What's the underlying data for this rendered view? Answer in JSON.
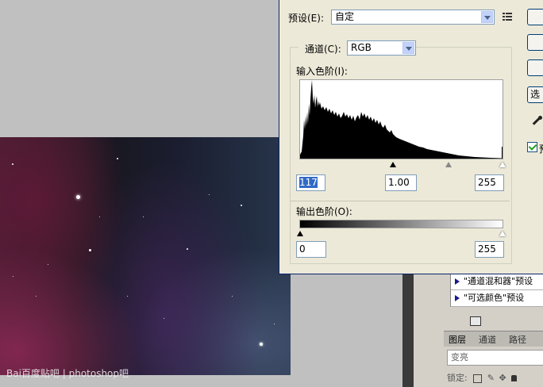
{
  "dialog": {
    "preset_label": "预设(E):",
    "preset_value": "自定",
    "channel_label": "通道(C):",
    "channel_value": "RGB",
    "input_levels_label": "输入色阶(I):",
    "output_levels_label": "输出色阶(O):",
    "input_black": "117",
    "input_gamma": "1.00",
    "input_white": "255",
    "output_black": "0",
    "output_white": "255",
    "button_partial": "选",
    "preview_partial": "预",
    "preset_menu_icon": "menu-list-icon",
    "eyedropper_icon": "eyedropper-icon"
  },
  "actions": {
    "items": [
      {
        "label": "\"通道混和器\"预设"
      },
      {
        "label": "\"可选颜色\"预设"
      }
    ]
  },
  "layers_panel": {
    "tabs": [
      "图层",
      "通道",
      "路径"
    ],
    "blend_mode": "变亮",
    "lock_label": "锁定:"
  },
  "watermark": {
    "text": "Bai百度贴吧 | photoshop吧"
  },
  "colors": {
    "dialog_bg": "#ece9d8",
    "selection": "#316ac5",
    "workspace": "#c0c0c0"
  }
}
